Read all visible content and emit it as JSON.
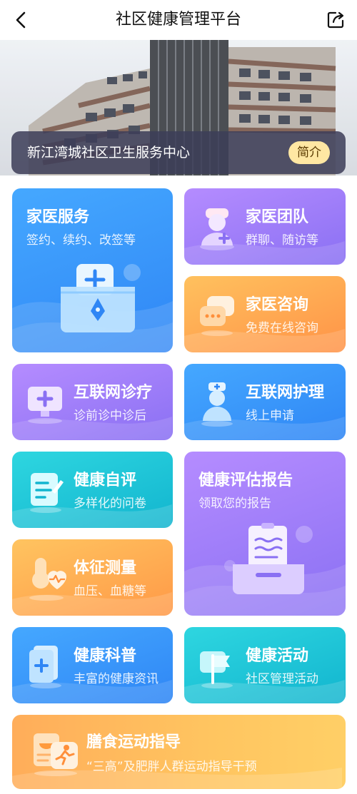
{
  "nav": {
    "title": "社区健康管理平台",
    "back_icon": "back-arrow-icon",
    "share_icon": "share-icon"
  },
  "banner": {
    "center_name": "新江湾城社区卫生服务中心",
    "intro_label": "简介"
  },
  "colors": {
    "blue": "#3a97fb",
    "purple": "#9f7ef9",
    "orange": "#ffa650",
    "cyan": "#1fc6d8",
    "intro_badge": "#ffe7a3"
  },
  "cards": {
    "family_doctor": {
      "title": "家医服务",
      "subtitle": "签约、续约、改签等",
      "icon": "folder-pen-icon"
    },
    "family_team": {
      "title": "家医团队",
      "subtitle": "群聊、随访等",
      "icon": "doctor-avatar-icon"
    },
    "family_consult": {
      "title": "家医咨询",
      "subtitle": "免费在线咨询",
      "icon": "chat-bubbles-icon"
    },
    "internet_clinic": {
      "title": "互联网诊疗",
      "subtitle": "诊前诊中诊后",
      "icon": "monitor-medical-icon"
    },
    "internet_nursing": {
      "title": "互联网护理",
      "subtitle": "线上申请",
      "icon": "nurse-icon"
    },
    "self_assessment": {
      "title": "健康自评",
      "subtitle": "多样化的问卷",
      "icon": "questionnaire-icon"
    },
    "assessment_report": {
      "title": "健康评估报告",
      "subtitle": "领取您的报告",
      "icon": "report-tray-icon"
    },
    "vital_signs": {
      "title": "体征测量",
      "subtitle": "血压、血糖等",
      "icon": "heart-rate-icon"
    },
    "health_science": {
      "title": "健康科普",
      "subtitle": "丰富的健康资讯",
      "icon": "medical-book-icon"
    },
    "health_activity": {
      "title": "健康活动",
      "subtitle": "社区管理活动",
      "icon": "flag-icon"
    },
    "diet_exercise": {
      "title": "膳食运动指导",
      "subtitle": "“三高”及肥胖人群运动指导干预",
      "icon": "diet-exercise-icon"
    }
  }
}
